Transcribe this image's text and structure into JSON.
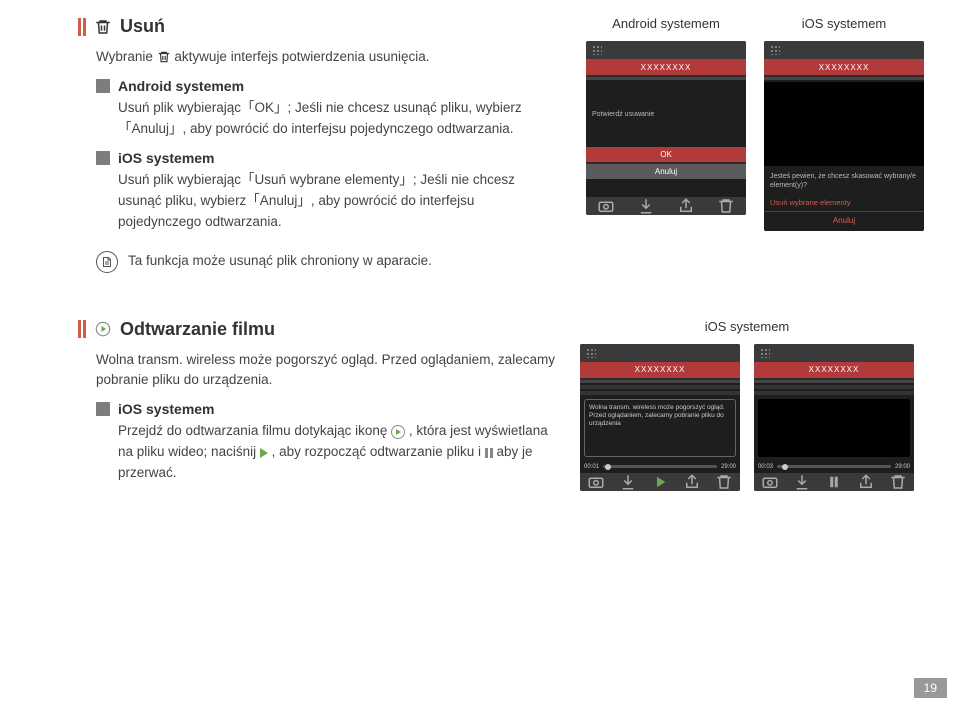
{
  "section1": {
    "title": "Usuń",
    "intro_a": "Wybranie ",
    "intro_b": " aktywuje interfejs potwierdzenia usunięcia.",
    "android": {
      "title": "Android systemem",
      "body": "Usuń plik wybierając「OK」; Jeśli nie chcesz usunąć pliku, wybierz「Anuluj」, aby powrócić do interfejsu pojedynczego odtwarzania."
    },
    "ios": {
      "title": "iOS systemem",
      "body": "Usuń plik wybierając「Usuń wybrane elementy」; Jeśli nie chcesz usunąć pliku, wybierz「Anuluj」, aby powrócić do interfejsu pojedynczego odtwarzania."
    },
    "note": "Ta funkcja może usunąć plik chroniony w aparacie."
  },
  "mock": {
    "androidLabel": "Android systemem",
    "iosLabel": "iOS systemem",
    "xxxx": "XXXXXXXX",
    "confirmDelete": "Potwierdź usuwanie",
    "ok": "OK",
    "cancel": "Anuluj",
    "iosPrompt": "Jesteś pewien, że chcesz skasować wybrany/e element(y)?",
    "deleteSelected": "Usuń wybrane elementy"
  },
  "section2": {
    "title": "Odtwarzanie filmu",
    "body": "Wolna transm. wireless może pogorszyć ogląd. Przed oglądaniem, zalecamy pobranie pliku do urządzenia.",
    "ios": {
      "title": "iOS systemem",
      "body_a": "Przejdź do odtwarzania filmu dotykając ikonę ",
      "body_b": ", która jest wyświetlana na pliku wideo; naciśnij ",
      "body_c": ", aby rozpocząć odtwarzanie pliku i ",
      "body_d": " aby je przerwać."
    },
    "mock": {
      "label": "iOS systemem",
      "xxxx": "XXXXXXXX",
      "msg": "Wolna transm. wireless może pogorszyć ogląd. Przed oglądaniem, zalecamy pobranie pliku do urządzenia",
      "t1a": "00:01",
      "t1b": "29:00",
      "t2a": "00:03",
      "t2b": "29:00"
    }
  },
  "pageNumber": "19"
}
